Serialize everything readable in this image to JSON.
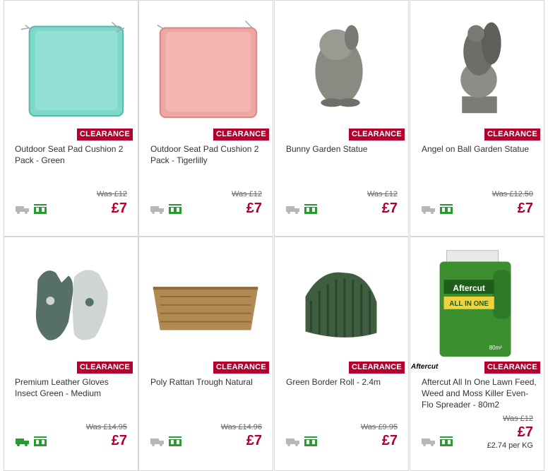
{
  "colors": {
    "accent": "#b5002d",
    "delivery_grey": "#b7b7b7",
    "delivery_green": "#2a9a33",
    "store_green": "#2a9a33"
  },
  "products": [
    {
      "title": "Outdoor Seat Pad Cushion 2 Pack - Green",
      "badge": "CLEARANCE",
      "was": "Was £12",
      "price": "£7",
      "image": "teal-seat-pad-image",
      "delivery_available": false
    },
    {
      "title": "Outdoor Seat Pad Cushion 2 Pack - Tigerlilly",
      "badge": "CLEARANCE",
      "was": "Was £12",
      "price": "£7",
      "image": "pink-seat-pad-image",
      "delivery_available": false
    },
    {
      "title": "Bunny Garden Statue",
      "badge": "CLEARANCE",
      "was": "Was £12",
      "price": "£7",
      "image": "bunny-statue-image",
      "delivery_available": false
    },
    {
      "title": "Angel on Ball Garden Statue",
      "badge": "CLEARANCE",
      "was": "Was £12.50",
      "price": "£7",
      "image": "angel-statue-image",
      "delivery_available": false
    },
    {
      "title": "Premium Leather Gloves Insect Green - Medium",
      "badge": "CLEARANCE",
      "was": "Was £14.95",
      "price": "£7",
      "image": "gloves-image",
      "delivery_available": true
    },
    {
      "title": "Poly Rattan Trough Natural",
      "badge": "CLEARANCE",
      "was": "Was £14.96",
      "price": "£7",
      "image": "rattan-trough-image",
      "delivery_available": false
    },
    {
      "title": "Green Border Roll - 2.4m",
      "badge": "CLEARANCE",
      "was": "Was £9.95",
      "price": "£7",
      "image": "border-roll-image",
      "delivery_available": false
    },
    {
      "title": "Aftercut All In One Lawn Feed, Weed and Moss Killer Even-Flo Spreader - 80m2",
      "badge": "CLEARANCE",
      "was": "Was £12",
      "price": "£7",
      "unit_price": "£2.74 per KG",
      "brand_logo": "Aftercut",
      "image": "aftercut-bottle-image",
      "delivery_available": false,
      "package_text": {
        "brand": "Aftercut",
        "line1": "ALL IN ONE",
        "line2": "80m²"
      }
    }
  ]
}
